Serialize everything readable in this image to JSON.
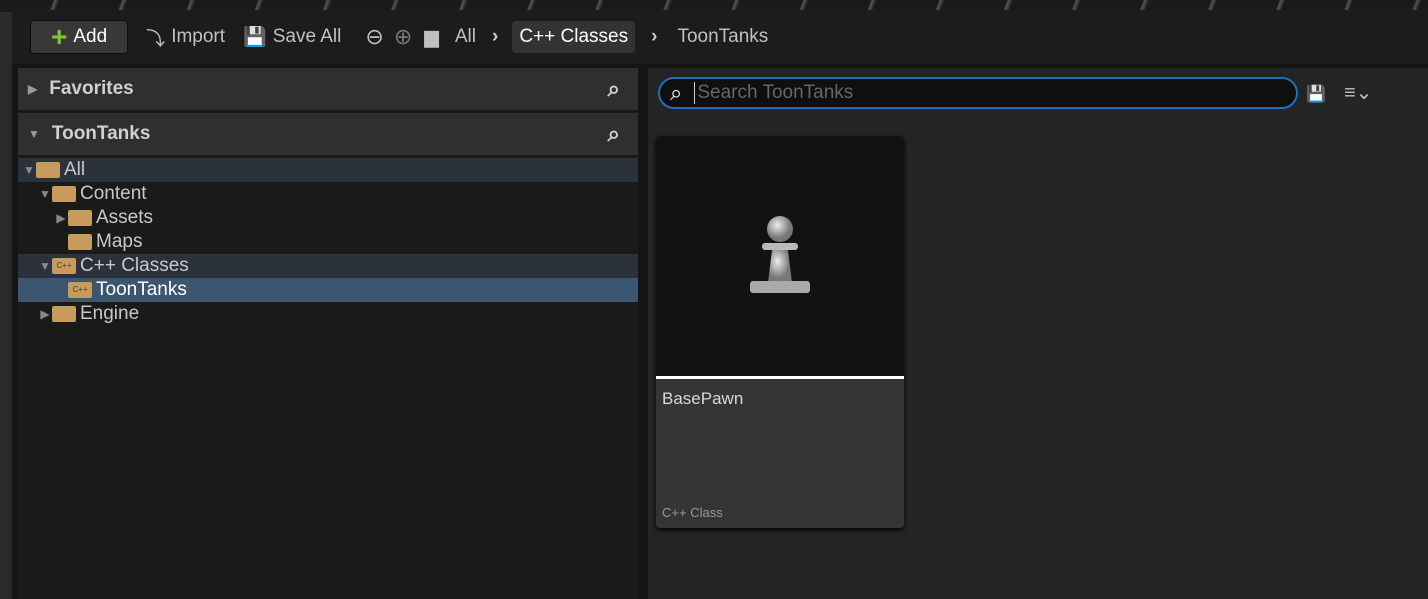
{
  "toolbar": {
    "add": "Add",
    "import": "Import",
    "save_all": "Save All",
    "breadcrumbs": [
      "All",
      "C++ Classes",
      "ToonTanks"
    ]
  },
  "sidebar": {
    "favorites": "Favorites",
    "project": "ToonTanks",
    "tree": [
      "All",
      "Content",
      "Assets",
      "Maps",
      "C++ Classes",
      "ToonTanks",
      "Engine"
    ],
    "cpp_badge": "C++"
  },
  "content": {
    "search_placeholder": "Search ToonTanks",
    "asset": {
      "name": "BasePawn",
      "type": "C++ Class"
    }
  }
}
